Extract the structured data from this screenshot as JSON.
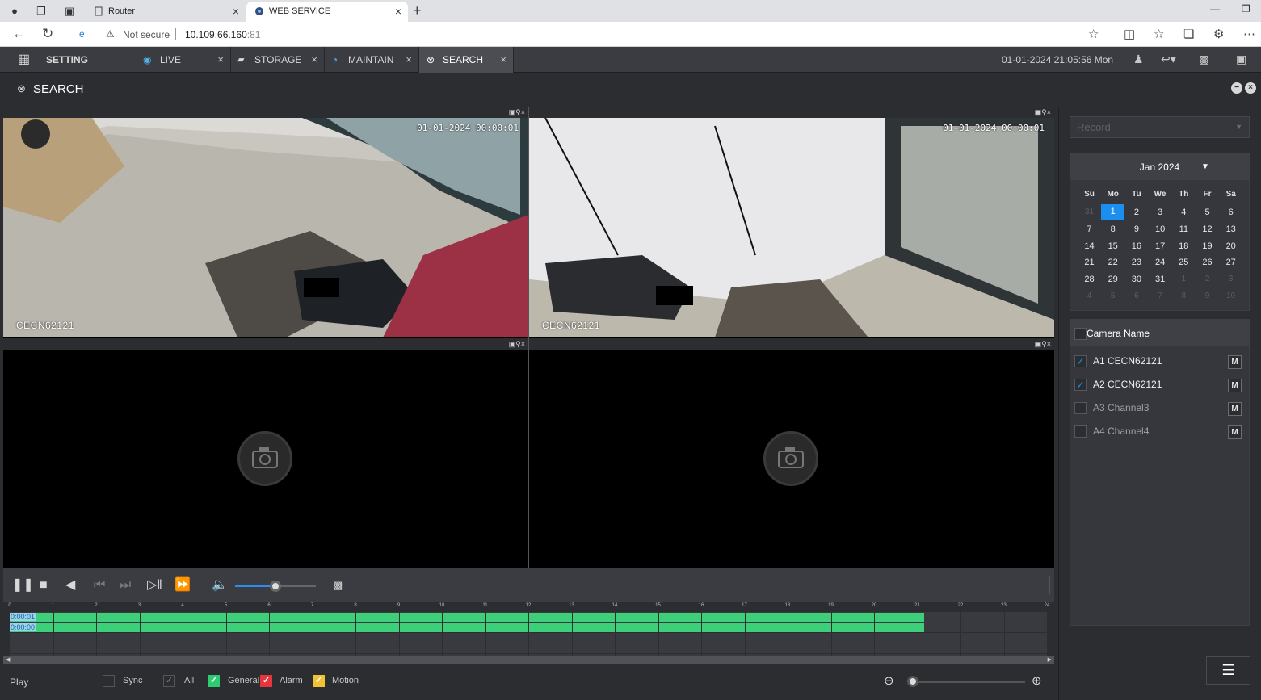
{
  "browser": {
    "tabs": [
      {
        "title": "Router"
      },
      {
        "title": "WEB SERVICE"
      }
    ],
    "address": {
      "security": "Not secure",
      "url": "10.109.66.160",
      "port": ":81"
    }
  },
  "app": {
    "tabs": [
      {
        "label": "SETTING"
      },
      {
        "label": "LIVE"
      },
      {
        "label": "STORAGE"
      },
      {
        "label": "MAINTAIN"
      },
      {
        "label": "SEARCH"
      }
    ],
    "datetime": "01-01-2024 21:05:56 Mon",
    "page_title": "SEARCH"
  },
  "video": {
    "cells": [
      {
        "timestamp": "01-01-2024 00:00:01",
        "camera": "CECN62121"
      },
      {
        "timestamp": "01-01-2024 00:00:01",
        "camera": "CECN62121"
      },
      {
        "timestamp": "",
        "camera": ""
      },
      {
        "timestamp": "",
        "camera": ""
      }
    ]
  },
  "playback": {
    "volume_fraction": 0.5
  },
  "timeline": {
    "hours": [
      "0",
      "1",
      "2",
      "3",
      "4",
      "5",
      "6",
      "7",
      "8",
      "9",
      "10",
      "11",
      "12",
      "13",
      "14",
      "15",
      "16",
      "17",
      "18",
      "19",
      "20",
      "21",
      "22",
      "23",
      "24"
    ],
    "rows": [
      {
        "label": "0:00:01",
        "recorded_until_hour": 21.15
      },
      {
        "label": "0:00:00",
        "recorded_until_hour": 21.15
      }
    ]
  },
  "bottom": {
    "mode": "Play",
    "sync": "Sync",
    "all": "All",
    "general": "General",
    "alarm": "Alarm",
    "motion": "Motion",
    "colors": {
      "general": "#2ecc71",
      "alarm": "#e5363d",
      "motion": "#f1c232"
    }
  },
  "panel": {
    "record_type": "Record",
    "calendar": {
      "month": "Jan 2024",
      "dow": [
        "Su",
        "Mo",
        "Tu",
        "We",
        "Th",
        "Fr",
        "Sa"
      ],
      "weeks": [
        [
          "31",
          "1",
          "2",
          "3",
          "4",
          "5",
          "6"
        ],
        [
          "7",
          "8",
          "9",
          "10",
          "11",
          "12",
          "13"
        ],
        [
          "14",
          "15",
          "16",
          "17",
          "18",
          "19",
          "20"
        ],
        [
          "21",
          "22",
          "23",
          "24",
          "25",
          "26",
          "27"
        ],
        [
          "28",
          "29",
          "30",
          "31",
          "1",
          "2",
          "3"
        ],
        [
          "4",
          "5",
          "6",
          "7",
          "8",
          "9",
          "10"
        ]
      ],
      "selected_day": "1"
    },
    "camera_header": "Camera Name",
    "cameras": [
      {
        "name": "A1 CECN62121",
        "checked": true,
        "m": "M"
      },
      {
        "name": "A2 CECN62121",
        "checked": true,
        "m": "M"
      },
      {
        "name": "A3 Channel3",
        "checked": false,
        "m": "M"
      },
      {
        "name": "A4 Channel4",
        "checked": false,
        "m": "M"
      }
    ]
  }
}
